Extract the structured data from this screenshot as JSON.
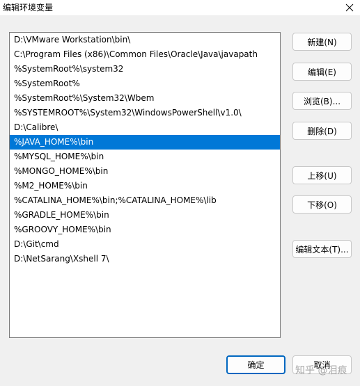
{
  "window": {
    "title": "编辑环境变量"
  },
  "path_list": {
    "items": [
      "D:\\VMware Workstation\\bin\\",
      "C:\\Program Files (x86)\\Common Files\\Oracle\\Java\\javapath",
      "%SystemRoot%\\system32",
      "%SystemRoot%",
      "%SystemRoot%\\System32\\Wbem",
      "%SYSTEMROOT%\\System32\\WindowsPowerShell\\v1.0\\",
      "D:\\Calibre\\",
      "%JAVA_HOME%\\bin",
      "%MYSQL_HOME%\\bin",
      "%MONGO_HOME%\\bin",
      "%M2_HOME%\\bin",
      "%CATALINA_HOME%\\bin;%CATALINA_HOME%\\lib",
      "%GRADLE_HOME%\\bin",
      "%GROOVY_HOME%\\bin",
      "D:\\Git\\cmd",
      "D:\\NetSarang\\Xshell 7\\"
    ],
    "selected_index": 7
  },
  "buttons": {
    "new": "新建(N)",
    "edit": "编辑(E)",
    "browse": "浏览(B)...",
    "delete": "删除(D)",
    "move_up": "上移(U)",
    "move_down": "下移(O)",
    "edit_text": "编辑文本(T)..."
  },
  "footer": {
    "ok": "确定",
    "cancel": "取消"
  },
  "watermark": "知乎 @泪痕",
  "colors": {
    "selection": "#0078d7",
    "ok_border": "#0067c0"
  }
}
